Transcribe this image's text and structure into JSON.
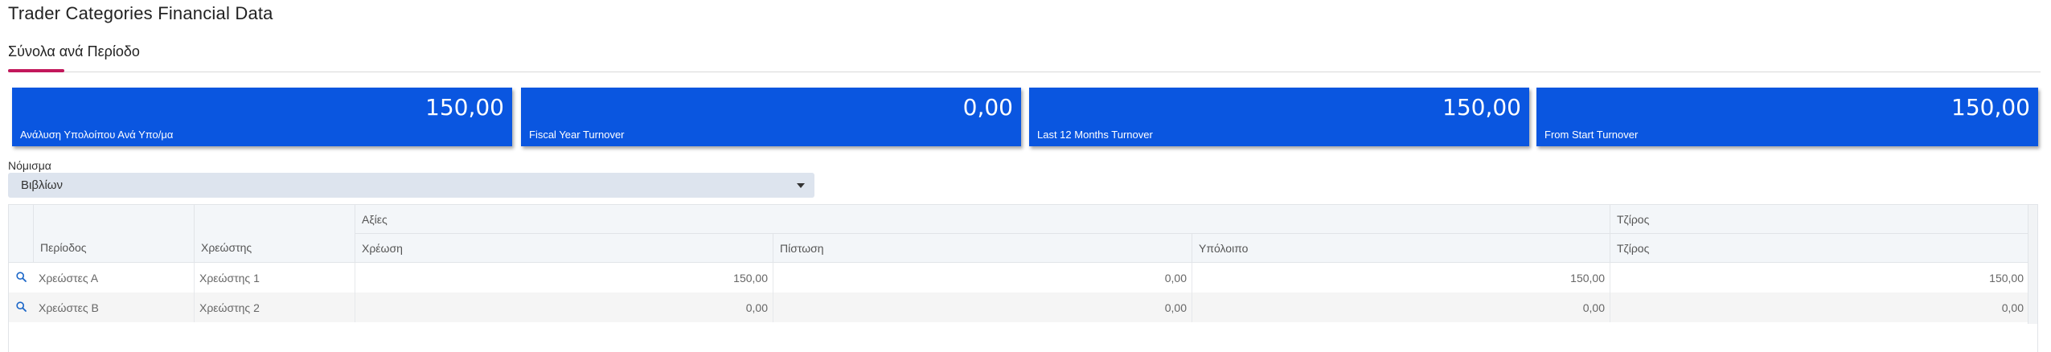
{
  "page": {
    "title": "Trader Categories Financial Data"
  },
  "tabs": [
    {
      "label": "Σύνολα ανά Περίοδο",
      "active": true
    }
  ],
  "cards": [
    {
      "value": "150,00",
      "label": "Ανάλυση Υπολοίπου Ανά Υπο/μα"
    },
    {
      "value": "0,00",
      "label": "Fiscal Year Turnover"
    },
    {
      "value": "150,00",
      "label": "Last 12 Months Turnover"
    },
    {
      "value": "150,00",
      "label": "From Start Turnover"
    }
  ],
  "currency": {
    "label": "Νόμισμα",
    "selected": "Βιβλίων"
  },
  "grid": {
    "group_headers": {
      "values": "Αξίες",
      "turnover": "Τζίρος"
    },
    "columns": {
      "period": "Περίοδος",
      "debtor": "Χρεώστης",
      "debit": "Χρέωση",
      "credit": "Πίστωση",
      "balance": "Υπόλοιπο",
      "turnover": "Τζίρος"
    },
    "rows": [
      {
        "period": "Χρεώστες Α",
        "debtor": "Χρεώστης 1",
        "debit": "150,00",
        "credit": "0,00",
        "balance": "150,00",
        "turnover": "150,00"
      },
      {
        "period": "Χρεώστες Β",
        "debtor": "Χρεώστης 2",
        "debit": "0,00",
        "credit": "0,00",
        "balance": "0,00",
        "turnover": "0,00"
      }
    ]
  },
  "colors": {
    "card_bg": "#0a56e0",
    "tab_accent": "#c2185b",
    "icon": "#1a66c8"
  }
}
